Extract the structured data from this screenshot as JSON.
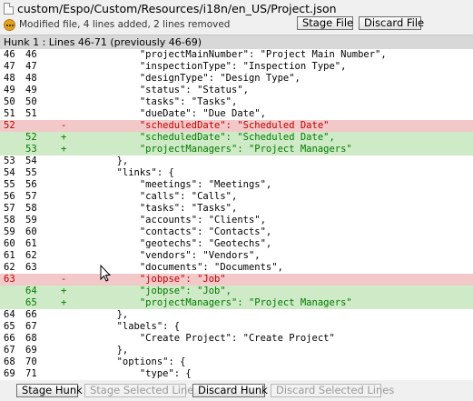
{
  "header": {
    "file_path": "custom/Espo/Custom/Resources/i18n/en_US/Project.json",
    "status": "Modified file, 4 lines added, 2 lines removed",
    "stage_file_label": "Stage File",
    "discard_file_label": "Discard File",
    "file_icon": "file-icon",
    "status_icon": "modified-icon"
  },
  "hunk": {
    "title": "Hunk 1 : Lines 46-71 (previously 46-69)"
  },
  "colors": {
    "removed_bg": "#f2c8c8",
    "added_bg": "#cfeac6",
    "removed_text": "#c00000",
    "added_text": "#007a00"
  },
  "lines": [
    {
      "old": "46",
      "new": "46",
      "sign": "",
      "type": "ctx",
      "text": "            \"projectMainNumber\": \"Project Main Number\","
    },
    {
      "old": "47",
      "new": "47",
      "sign": "",
      "type": "ctx",
      "text": "            \"inspectionType\": \"Inspection Type\","
    },
    {
      "old": "48",
      "new": "48",
      "sign": "",
      "type": "ctx",
      "text": "            \"designType\": \"Design Type\","
    },
    {
      "old": "49",
      "new": "49",
      "sign": "",
      "type": "ctx",
      "text": "            \"status\": \"Status\","
    },
    {
      "old": "50",
      "new": "50",
      "sign": "",
      "type": "ctx",
      "text": "            \"tasks\": \"Tasks\","
    },
    {
      "old": "51",
      "new": "51",
      "sign": "",
      "type": "ctx",
      "text": "            \"dueDate\": \"Due Date\","
    },
    {
      "old": "52",
      "new": "",
      "sign": "-",
      "type": "del",
      "text": "            \"scheduledDate\": \"Scheduled Date\""
    },
    {
      "old": "",
      "new": "52",
      "sign": "+",
      "type": "add",
      "text": "            \"scheduledDate\": \"Scheduled Date\","
    },
    {
      "old": "",
      "new": "53",
      "sign": "+",
      "type": "add",
      "text": "            \"projectManagers\": \"Project Managers\""
    },
    {
      "old": "53",
      "new": "54",
      "sign": "",
      "type": "ctx",
      "text": "        },"
    },
    {
      "old": "54",
      "new": "55",
      "sign": "",
      "type": "ctx",
      "text": "        \"links\": {"
    },
    {
      "old": "55",
      "new": "56",
      "sign": "",
      "type": "ctx",
      "text": "            \"meetings\": \"Meetings\","
    },
    {
      "old": "56",
      "new": "57",
      "sign": "",
      "type": "ctx",
      "text": "            \"calls\": \"Calls\","
    },
    {
      "old": "57",
      "new": "58",
      "sign": "",
      "type": "ctx",
      "text": "            \"tasks\": \"Tasks\","
    },
    {
      "old": "58",
      "new": "59",
      "sign": "",
      "type": "ctx",
      "text": "            \"accounts\": \"Clients\","
    },
    {
      "old": "59",
      "new": "60",
      "sign": "",
      "type": "ctx",
      "text": "            \"contacts\": \"Contacts\","
    },
    {
      "old": "60",
      "new": "61",
      "sign": "",
      "type": "ctx",
      "text": "            \"geotechs\": \"Geotechs\","
    },
    {
      "old": "61",
      "new": "62",
      "sign": "",
      "type": "ctx",
      "text": "            \"vendors\": \"Vendors\","
    },
    {
      "old": "62",
      "new": "63",
      "sign": "",
      "type": "ctx",
      "text": "            \"documents\": \"Documents\","
    },
    {
      "old": "63",
      "new": "",
      "sign": "-",
      "type": "del",
      "text": "            \"jobpse\": \"Job\""
    },
    {
      "old": "",
      "new": "64",
      "sign": "+",
      "type": "add",
      "text": "            \"jobpse\": \"Job\","
    },
    {
      "old": "",
      "new": "65",
      "sign": "+",
      "type": "add",
      "text": "            \"projectManagers\": \"Project Managers\""
    },
    {
      "old": "64",
      "new": "66",
      "sign": "",
      "type": "ctx",
      "text": "        },"
    },
    {
      "old": "65",
      "new": "67",
      "sign": "",
      "type": "ctx",
      "text": "        \"labels\": {"
    },
    {
      "old": "66",
      "new": "68",
      "sign": "",
      "type": "ctx",
      "text": "            \"Create Project\": \"Create Project\""
    },
    {
      "old": "67",
      "new": "69",
      "sign": "",
      "type": "ctx",
      "text": "        },"
    },
    {
      "old": "68",
      "new": "70",
      "sign": "",
      "type": "ctx",
      "text": "        \"options\": {"
    },
    {
      "old": "69",
      "new": "71",
      "sign": "",
      "type": "ctx",
      "text": "            \"type\": {"
    }
  ],
  "footer": {
    "stage_hunk_label": "Stage Hunk",
    "stage_selected_label": "Stage Selected Lines",
    "discard_hunk_label": "Discard Hunk",
    "discard_selected_label": "Discard Selected Lines"
  }
}
